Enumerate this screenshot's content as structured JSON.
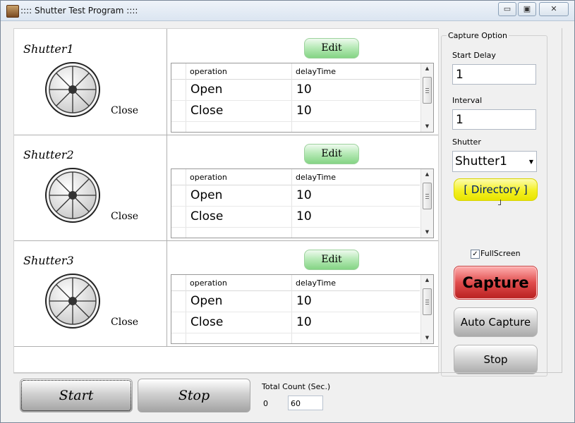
{
  "window": {
    "title": ":::: Shutter Test Program ::::"
  },
  "title_buttons": {
    "minimize": "▭",
    "maximize": "▣",
    "close": "✕"
  },
  "shutters": [
    {
      "name": "Shutter1",
      "status": "Close",
      "edit_label": "Edit",
      "columns": [
        "operation",
        "delayTime"
      ],
      "rows": [
        {
          "operation": "Open",
          "delay": "10"
        },
        {
          "operation": "Close",
          "delay": "10"
        }
      ]
    },
    {
      "name": "Shutter2",
      "status": "Close",
      "edit_label": "Edit",
      "columns": [
        "operation",
        "delayTime"
      ],
      "rows": [
        {
          "operation": "Open",
          "delay": "10"
        },
        {
          "operation": "Close",
          "delay": "10"
        }
      ]
    },
    {
      "name": "Shutter3",
      "status": "Close",
      "edit_label": "Edit",
      "columns": [
        "operation",
        "delayTime"
      ],
      "rows": [
        {
          "operation": "Open",
          "delay": "10"
        },
        {
          "operation": "Close",
          "delay": "10"
        }
      ]
    }
  ],
  "capture_option": {
    "legend": "Capture Option",
    "start_delay_label": "Start Delay",
    "start_delay_value": "1",
    "interval_label": "Interval",
    "interval_value": "1",
    "shutter_label": "Shutter",
    "shutter_selected": "Shutter1",
    "directory_label": "[ Directory ]",
    "fullscreen_label": "FullScreen",
    "fullscreen_checked": true,
    "capture_label": "Capture",
    "auto_capture_label": "Auto Capture",
    "stop_label": "Stop"
  },
  "bottom": {
    "start_label": "Start",
    "stop_label": "Stop",
    "total_count_label": "Total Count (Sec.)",
    "count_value": "0",
    "seconds_value": "60"
  },
  "colors": {
    "edit_green": "#84d484",
    "capture_red": "#e04c4c",
    "directory_yellow": "#f4f022"
  },
  "icons": {
    "shutter": "shutter-wheel-icon",
    "app": "app-icon"
  }
}
